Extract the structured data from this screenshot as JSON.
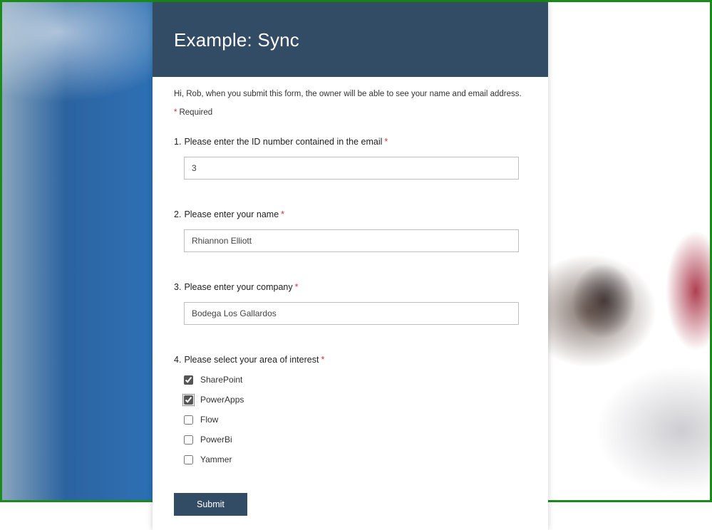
{
  "header": {
    "title": "Example: Sync"
  },
  "greeting": "Hi, Rob, when you submit this form, the owner will be able to see your name and email address.",
  "requiredLabel": "Required",
  "questions": {
    "q1": {
      "num": "1.",
      "label": "Please enter the ID number contained in the email",
      "value": "3",
      "required": true
    },
    "q2": {
      "num": "2.",
      "label": "Please enter your name",
      "value": "Rhiannon Elliott",
      "required": true
    },
    "q3": {
      "num": "3.",
      "label": "Please enter your company",
      "value": "Bodega Los Gallardos",
      "required": true
    },
    "q4": {
      "num": "4.",
      "label": "Please select your area of interest",
      "required": true,
      "options": [
        {
          "label": "SharePoint",
          "checked": true,
          "focused": false
        },
        {
          "label": "PowerApps",
          "checked": true,
          "focused": true
        },
        {
          "label": "Flow",
          "checked": false,
          "focused": false
        },
        {
          "label": "PowerBi",
          "checked": false,
          "focused": false
        },
        {
          "label": "Yammer",
          "checked": false,
          "focused": false
        }
      ]
    }
  },
  "submitLabel": "Submit"
}
